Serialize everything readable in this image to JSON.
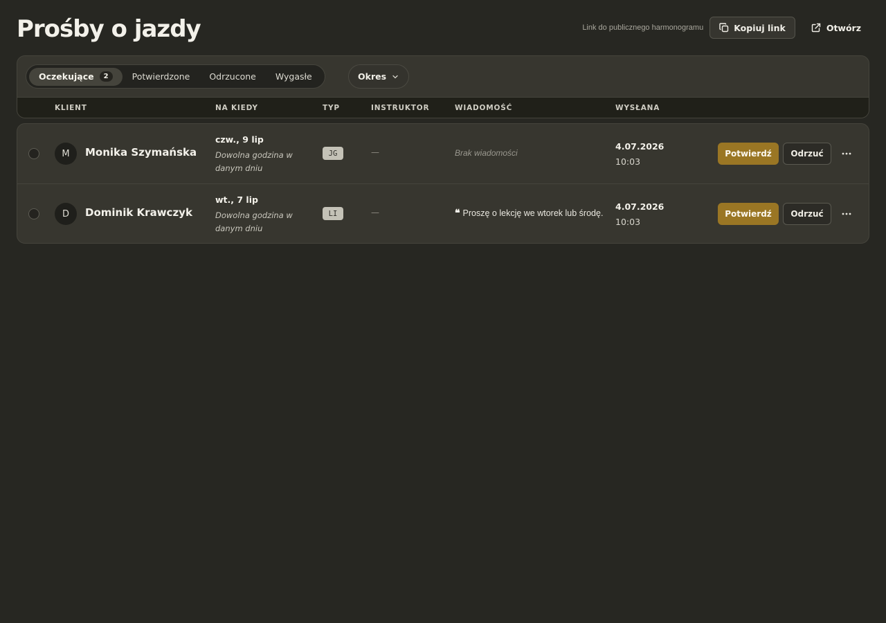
{
  "header": {
    "title": "Prośby o jazdy",
    "public_link_label": "Link do publicznego harmonogramu",
    "copy_link_label": "Kopiuj link",
    "open_label": "Otwórz"
  },
  "filters": {
    "tabs": [
      {
        "label": "Oczekujące",
        "count": "2",
        "active": true
      },
      {
        "label": "Potwierdzone"
      },
      {
        "label": "Odrzucone"
      },
      {
        "label": "Wygasłe"
      }
    ],
    "period_label": "Okres"
  },
  "columns": {
    "client": "KLIENT",
    "when": "NA KIEDY",
    "type": "TYP",
    "instructor": "INSTRUKTOR",
    "message": "WIADOMOŚĆ",
    "sent": "WYSŁANA"
  },
  "rows": [
    {
      "initial": "M",
      "name": "Monika Szymańska",
      "when_date": "czw., 9 lip",
      "when_note": "Dowolna godzina w danym dniu",
      "type": "JG",
      "instructor": "—",
      "message_empty": "Brak wiadomości",
      "sent_date": "4.07.2026",
      "sent_time": "10:03",
      "confirm_label": "Potwierdź",
      "reject_label": "Odrzuć"
    },
    {
      "initial": "D",
      "name": "Dominik Krawczyk",
      "when_date": "wt., 7 lip",
      "when_note": "Dowolna godzina w danym dniu",
      "type": "LI",
      "instructor": "—",
      "message_quote": "❝",
      "message": "Proszę o lekcję we wtorek lub środę.",
      "sent_date": "4.07.2026",
      "sent_time": "10:03",
      "confirm_label": "Potwierdź",
      "reject_label": "Odrzuć"
    }
  ],
  "icons": {
    "copy": "copy-icon",
    "open": "external-link-icon",
    "chevron": "chevron-down-icon",
    "more": "more-horizontal-icon",
    "quote": "quote-icon"
  },
  "colors": {
    "background": "#272722",
    "card": "#37362f",
    "accent": "#9a7624"
  }
}
